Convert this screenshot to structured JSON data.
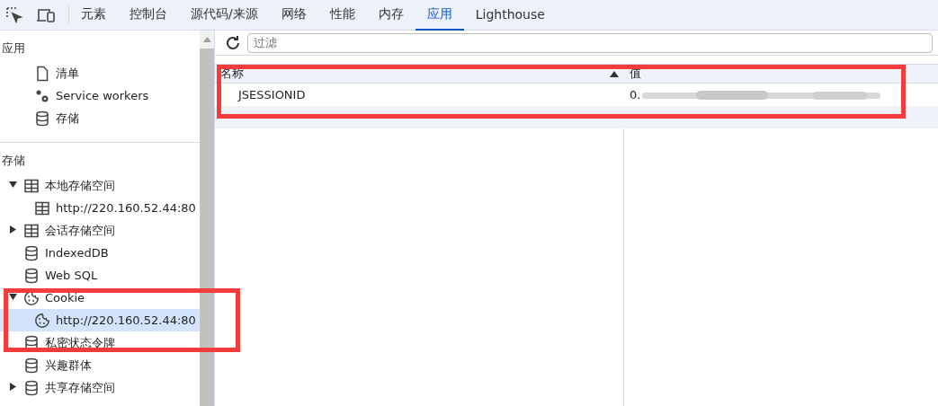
{
  "toolbar": {
    "tabs": [
      {
        "label": "元素",
        "selected": false
      },
      {
        "label": "控制台",
        "selected": false
      },
      {
        "label": "源代码/来源",
        "selected": false
      },
      {
        "label": "网络",
        "selected": false
      },
      {
        "label": "性能",
        "selected": false
      },
      {
        "label": "内存",
        "selected": false
      },
      {
        "label": "应用",
        "selected": true
      },
      {
        "label": "Lighthouse",
        "selected": false
      }
    ]
  },
  "sidebar": {
    "sections": [
      {
        "title": "应用",
        "items": [
          {
            "label": "清单",
            "kind": "file",
            "selected": false
          },
          {
            "label": "Service workers",
            "kind": "gears",
            "selected": false
          },
          {
            "label": "存储",
            "kind": "db",
            "selected": false
          }
        ]
      },
      {
        "title": "存储",
        "items": [
          {
            "label": "本地存储空间",
            "kind": "table",
            "expanded": true,
            "selected": false,
            "children": [
              {
                "label": "http://220.160.52.44:80",
                "kind": "table",
                "selected": false
              }
            ]
          },
          {
            "label": "会话存储空间",
            "kind": "table",
            "expanded": false,
            "selected": false
          },
          {
            "label": "IndexedDB",
            "kind": "db",
            "selected": false
          },
          {
            "label": "Web SQL",
            "kind": "db",
            "selected": false
          },
          {
            "label": "Cookie",
            "kind": "cookie",
            "expanded": true,
            "selected": false,
            "children": [
              {
                "label": "http://220.160.52.44:80",
                "kind": "cookie",
                "selected": true
              }
            ]
          },
          {
            "label": "私密状态令牌",
            "kind": "db",
            "selected": false
          },
          {
            "label": "兴趣群体",
            "kind": "db",
            "selected": false
          },
          {
            "label": "共享存储空间",
            "kind": "db",
            "expanded": false,
            "selected": false
          }
        ]
      }
    ]
  },
  "filter": {
    "placeholder": "过滤"
  },
  "table": {
    "columns": [
      "名称",
      "值"
    ],
    "rows": [
      {
        "name": "JSESSIONID",
        "value": "0."
      }
    ]
  }
}
